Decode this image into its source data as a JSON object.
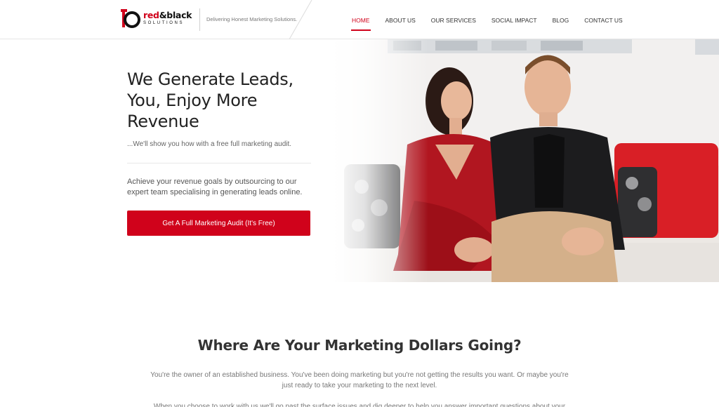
{
  "header": {
    "logo_word_red": "red",
    "logo_word_rest": "&black",
    "logo_sub": "SOLUTIONS",
    "tagline": "Delivering Honest Marketing Solutions.",
    "nav": [
      {
        "label": "HOME",
        "active": true
      },
      {
        "label": "ABOUT US",
        "active": false
      },
      {
        "label": "OUR SERVICES",
        "active": false
      },
      {
        "label": "SOCIAL IMPACT",
        "active": false
      },
      {
        "label": "BLOG",
        "active": false
      },
      {
        "label": "CONTACT US",
        "active": false
      }
    ]
  },
  "hero": {
    "title": "We Generate Leads, You, Enjoy More Revenue",
    "subtitle": "...We'll show you how with a free full marketing audit.",
    "body": "Achieve your revenue goals by outsourcing to our expert team specialising in generating leads online.",
    "cta_label": "Get A Full Marketing Audit (It's Free)"
  },
  "section": {
    "title": "Where Are Your Marketing Dollars Going?",
    "paragraph1": "You're the owner of an established business. You've been doing marketing but you're not getting the results you want. Or maybe you're just ready to take your marketing to the next level.",
    "paragraph2": "When you choose to work with us we'll go past the surface issues and dig deeper to help you answer important questions about your"
  },
  "colors": {
    "brand_red": "#d0021b",
    "text_dark": "#222222",
    "text_muted": "#777777"
  }
}
